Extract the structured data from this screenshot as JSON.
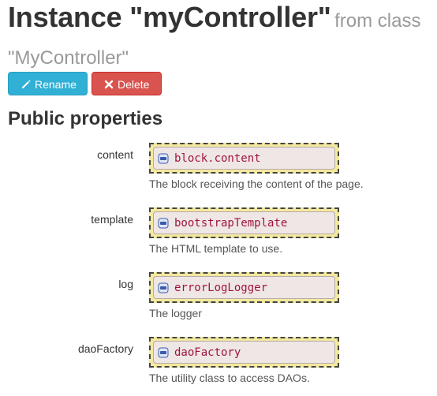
{
  "header": {
    "title_prefix": "Instance \"myController\"",
    "title_suffix": "from class \"MyController\""
  },
  "actions": {
    "rename_label": "Rename",
    "delete_label": "Delete"
  },
  "section": {
    "title": "Public properties"
  },
  "properties": [
    {
      "name": "content",
      "value": "block.content",
      "description": "The block receiving the content of the page."
    },
    {
      "name": "template",
      "value": "bootstrapTemplate",
      "description": "The HTML template to use."
    },
    {
      "name": "log",
      "value": "errorLogLogger",
      "description": "The logger"
    },
    {
      "name": "daoFactory",
      "value": "daoFactory",
      "description": "The utility class to access DAOs."
    }
  ],
  "colors": {
    "rename_button": "#31b0d5",
    "delete_button": "#d9534f",
    "property_box": "#f3e99f",
    "property_value": "#a0153e"
  },
  "icons": {
    "rename": "pencil-icon",
    "delete": "close-icon",
    "instance": "instance-icon"
  }
}
